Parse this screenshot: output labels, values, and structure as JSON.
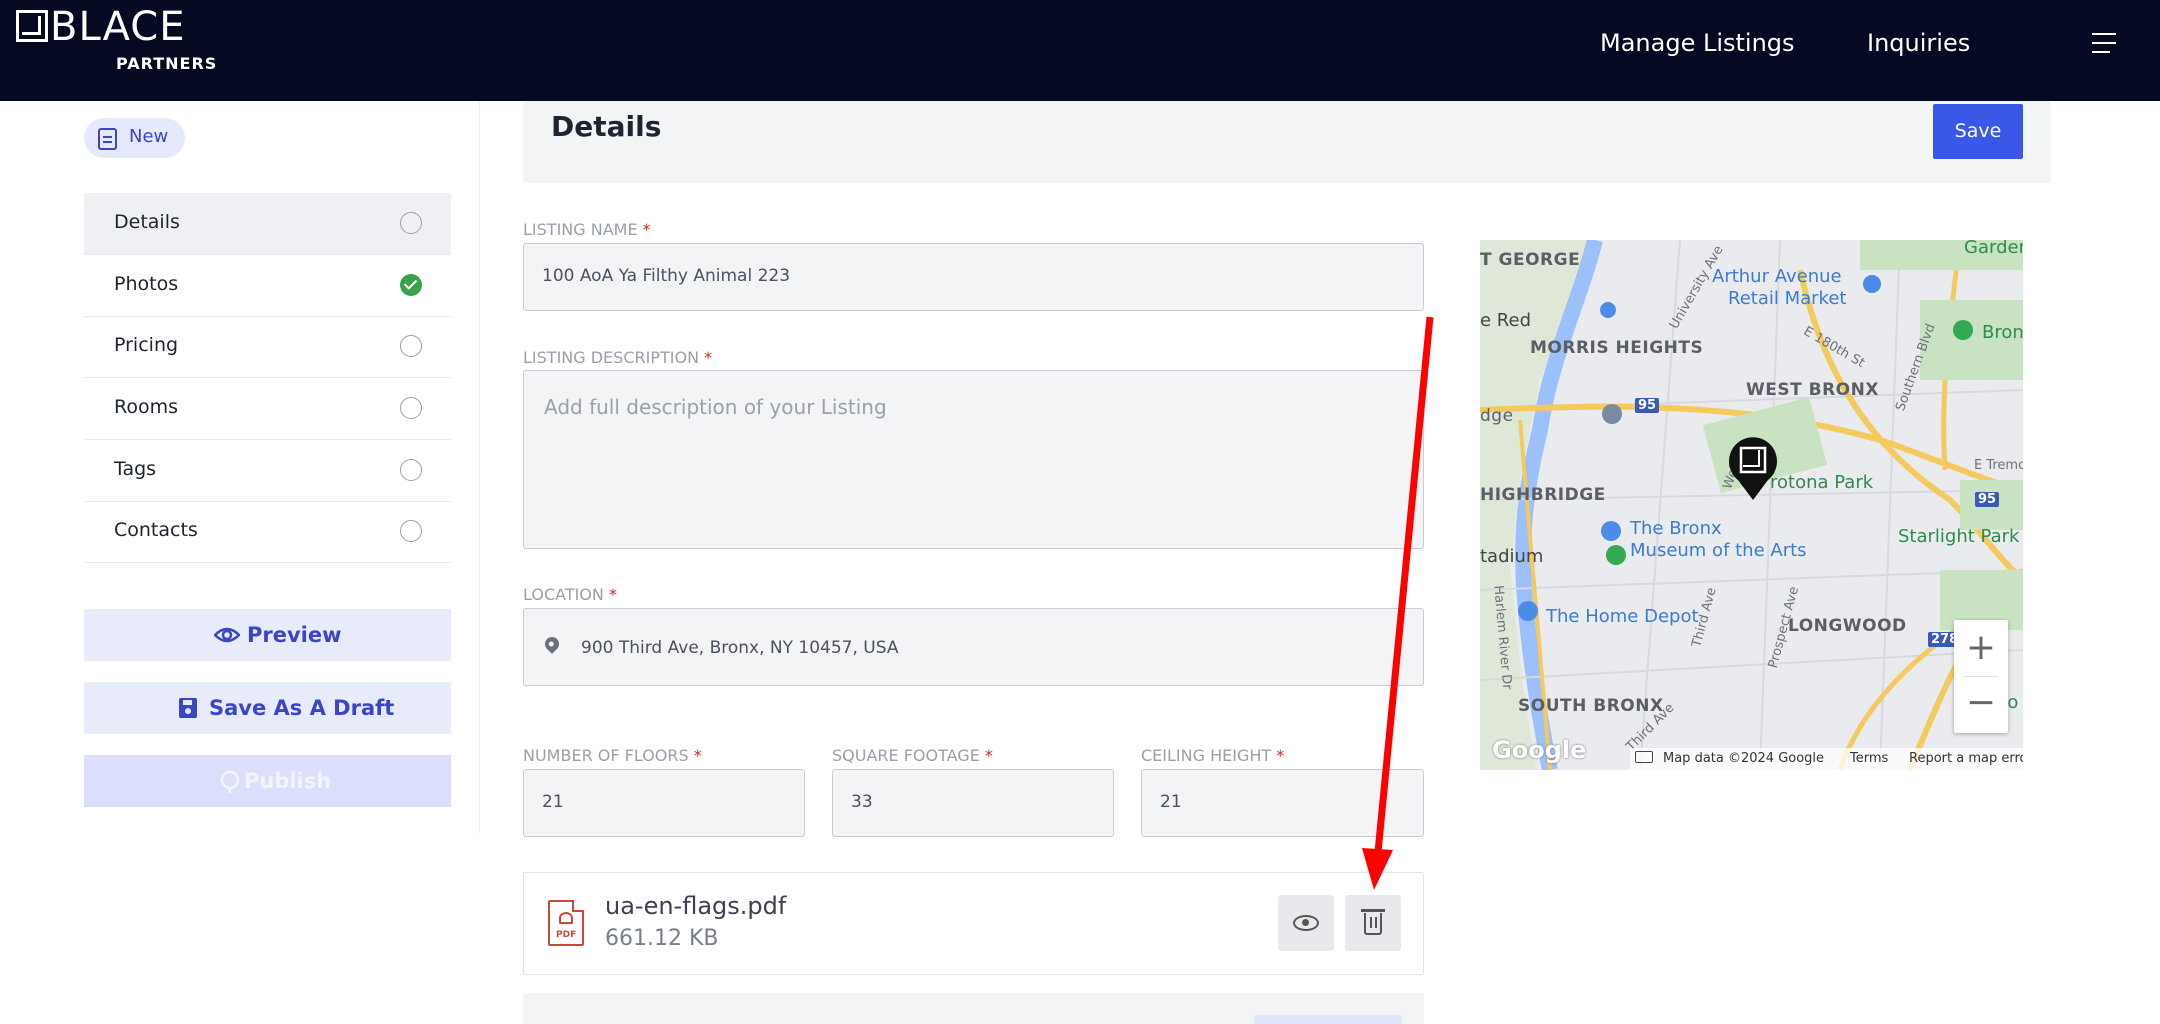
{
  "app": {
    "brand": "BLACE",
    "brand_sub": "PARTNERS",
    "nav": [
      "Manage Listings",
      "Inquiries"
    ],
    "menu_icon": "hamburger-icon"
  },
  "sidebar": {
    "new_label": "New",
    "steps": [
      {
        "label": "Details",
        "state": "active"
      },
      {
        "label": "Photos",
        "state": "done"
      },
      {
        "label": "Pricing",
        "state": "empty"
      },
      {
        "label": "Rooms",
        "state": "empty"
      },
      {
        "label": "Tags",
        "state": "empty"
      },
      {
        "label": "Contacts",
        "state": "empty"
      }
    ],
    "preview_label": "Preview",
    "draft_label": "Save As A Draft",
    "publish_label": "Publish"
  },
  "details": {
    "title": "Details",
    "save_label": "Save",
    "listing_name": {
      "label": "LISTING NAME",
      "value": "100 AoA Ya Filthy Animal 223"
    },
    "listing_description": {
      "label": "LISTING DESCRIPTION",
      "placeholder": "Add full description of your Listing"
    },
    "location": {
      "label": "LOCATION",
      "value": "900 Third Ave, Bronx, NY 10457, USA"
    },
    "floors": {
      "label": "NUMBER OF FLOORS",
      "value": "21"
    },
    "square_footage": {
      "label": "SQUARE FOOTAGE",
      "value": "33"
    },
    "ceiling_height": {
      "label": "CEILING HEIGHT",
      "value": "21"
    },
    "required_mark": "*"
  },
  "map": {
    "labels": {
      "st_george": "T GEORGE",
      "arthur_avenue": "Arthur Avenue",
      "retail_market": "Retail Market",
      "garden": "Garden",
      "red": "e Red",
      "morris_heights": "MORRIS HEIGHTS",
      "west_bronx": "WEST BRONX",
      "bron": "Bron",
      "highbridge": "HIGHBRIDGE",
      "crotona_park": "rotona Park",
      "e_tremont": "E Tremon",
      "the_bronx": "The Bronx",
      "museum": "Museum of the Arts",
      "starlight_park": "Starlight Park",
      "stadium": "tadium",
      "home_depot": "The Home Depot",
      "longwood": "LONGWOOD",
      "south_bronx": "SOUTH BRONX",
      "sou": "So",
      "university_ave": "University Ave",
      "e_180th": "E 180th St",
      "southern_blvd": "Southern Blvd",
      "third_ave": "Third Ave",
      "prospect_ave": "Prospect Ave",
      "harlem_river": "Harlem River Dr",
      "web": "Web",
      "dge": "dge",
      "third_ave2": "Third Ave"
    },
    "highway_95": "95",
    "highway_278": "278",
    "footer": {
      "data": "Map data ©2024 Google",
      "terms": "Terms",
      "report": "Report a map error"
    },
    "google": "Google",
    "zoom_in": "+",
    "zoom_out": "−"
  },
  "file": {
    "name": "ua-en-flags.pdf",
    "size": "661.12 KB",
    "icon_text": "PDF"
  },
  "colors": {
    "topbar": "#050a22",
    "accent": "#3a57e8",
    "success": "#37a24a",
    "annotation": "#ff0000"
  }
}
